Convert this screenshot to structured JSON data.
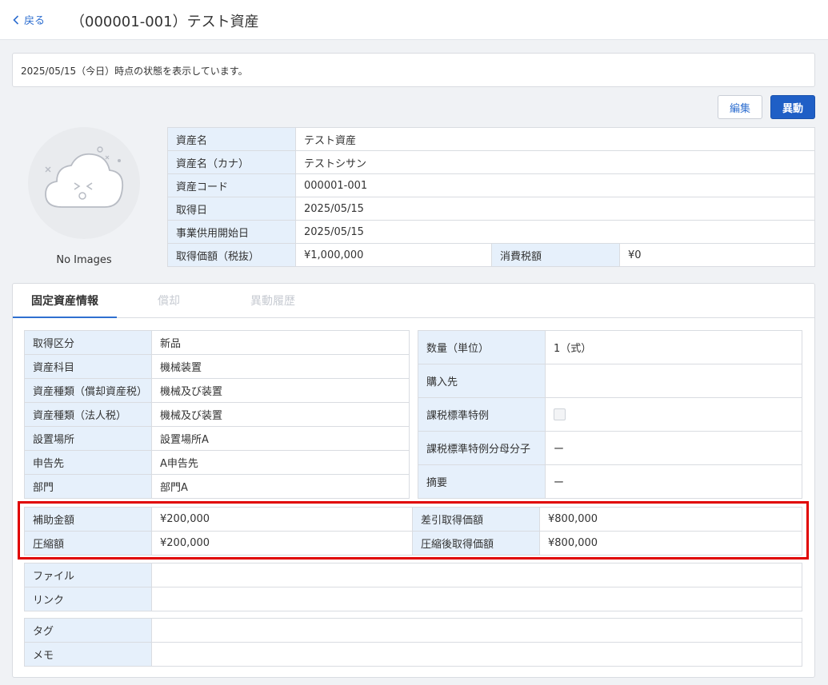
{
  "header": {
    "back_label": "戻る",
    "title": "（000001-001）テスト資産"
  },
  "notice": "2025/05/15（今日）時点の状態を表示しています。",
  "actions": {
    "edit": "編集",
    "move": "異動"
  },
  "image": {
    "placeholder": "No Images"
  },
  "asset_info": [
    {
      "label": "資産名",
      "value": "テスト資産"
    },
    {
      "label": "資産名（カナ）",
      "value": "テストシサン"
    },
    {
      "label": "資産コード",
      "value": "000001-001"
    },
    {
      "label": "取得日",
      "value": "2025/05/15"
    },
    {
      "label": "事業供用開始日",
      "value": "2025/05/15"
    },
    {
      "label": "取得価額（税抜）",
      "value": "¥1,000,000",
      "label2": "消費税額",
      "value2": "¥0"
    }
  ],
  "tabs": [
    "固定資産情報",
    "償却",
    "異動履歴"
  ],
  "left_details": [
    {
      "label": "取得区分",
      "value": "新品"
    },
    {
      "label": "資産科目",
      "value": "機械装置"
    },
    {
      "label": "資産種類（償却資産税）",
      "value": "機械及び装置"
    },
    {
      "label": "資産種類（法人税）",
      "value": "機械及び装置"
    },
    {
      "label": "設置場所",
      "value": "設置場所A"
    },
    {
      "label": "申告先",
      "value": "A申告先"
    },
    {
      "label": "部門",
      "value": "部門A"
    }
  ],
  "right_details": [
    {
      "label": "数量（単位）",
      "value": "1（式）"
    },
    {
      "label": "購入先",
      "value": ""
    },
    {
      "label": "課税標準特例",
      "value": ""
    },
    {
      "label": "課税標準特例分母分子",
      "value": "ー"
    },
    {
      "label": "摘要",
      "value": "ー"
    }
  ],
  "subsidy": [
    {
      "label": "補助金額",
      "value": "¥200,000",
      "label2": "差引取得価額",
      "value2": "¥800,000"
    },
    {
      "label": "圧縮額",
      "value": "¥200,000",
      "label2": "圧縮後取得価額",
      "value2": "¥800,000"
    }
  ],
  "files": [
    {
      "label": "ファイル",
      "value": ""
    },
    {
      "label": "リンク",
      "value": ""
    }
  ],
  "tags": [
    {
      "label": "タグ",
      "value": ""
    },
    {
      "label": "メモ",
      "value": ""
    }
  ],
  "colors": {
    "accent": "#2f6fd0",
    "primary_button": "#1f5fc6",
    "label_bg": "#e6f0fb",
    "highlight": "#e00000"
  }
}
